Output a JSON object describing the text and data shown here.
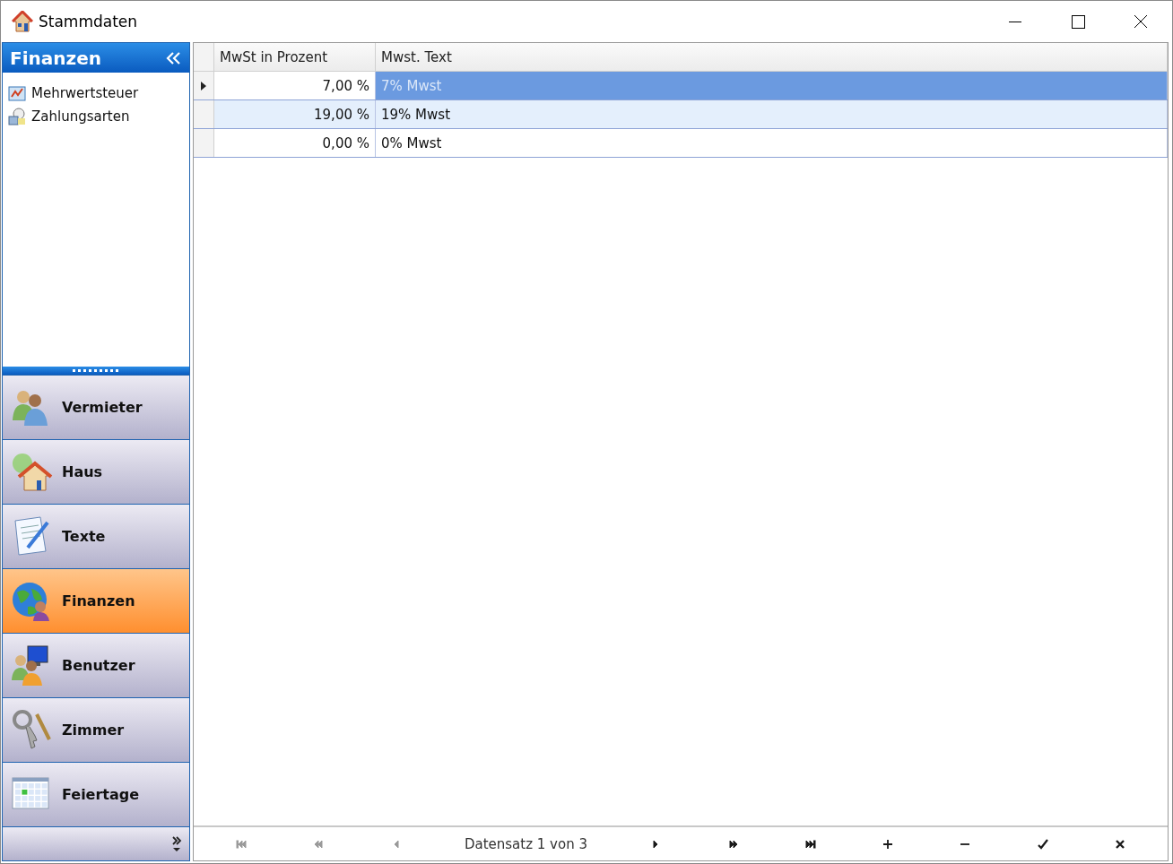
{
  "window": {
    "title": "Stammdaten"
  },
  "sidebar": {
    "title": "Finanzen",
    "items": [
      {
        "label": "Mehrwertsteuer",
        "kind": "tax"
      },
      {
        "label": "Zahlungsarten",
        "kind": "payment"
      }
    ],
    "groups": [
      {
        "label": "Vermieter",
        "kind": "people",
        "selected": false
      },
      {
        "label": "Haus",
        "kind": "house",
        "selected": false
      },
      {
        "label": "Texte",
        "kind": "texts",
        "selected": false
      },
      {
        "label": "Finanzen",
        "kind": "globe",
        "selected": true
      },
      {
        "label": "Benutzer",
        "kind": "users",
        "selected": false
      },
      {
        "label": "Zimmer",
        "kind": "keys",
        "selected": false
      },
      {
        "label": "Feiertage",
        "kind": "calendar",
        "selected": false
      }
    ]
  },
  "table": {
    "columns": [
      "MwSt in Prozent",
      "Mwst. Text"
    ],
    "rows": [
      {
        "cells": [
          "7,00 %",
          "7% Mwst"
        ],
        "selected": true,
        "highlighted": false
      },
      {
        "cells": [
          "19,00 %",
          "19% Mwst"
        ],
        "selected": false,
        "highlighted": true
      },
      {
        "cells": [
          "0,00 %",
          "0% Mwst"
        ],
        "selected": false,
        "highlighted": false
      }
    ]
  },
  "navigator": {
    "record_text": "Datensatz 1 von 3",
    "buttons": [
      {
        "kind": "first",
        "disabled": true
      },
      {
        "kind": "prev-page",
        "disabled": true
      },
      {
        "kind": "prev",
        "disabled": true
      },
      {
        "kind": "next",
        "disabled": false
      },
      {
        "kind": "next-page",
        "disabled": false
      },
      {
        "kind": "last",
        "disabled": false
      },
      {
        "kind": "add",
        "disabled": false
      },
      {
        "kind": "remove",
        "disabled": false
      },
      {
        "kind": "confirm",
        "disabled": false
      },
      {
        "kind": "cancel",
        "disabled": false
      }
    ]
  }
}
